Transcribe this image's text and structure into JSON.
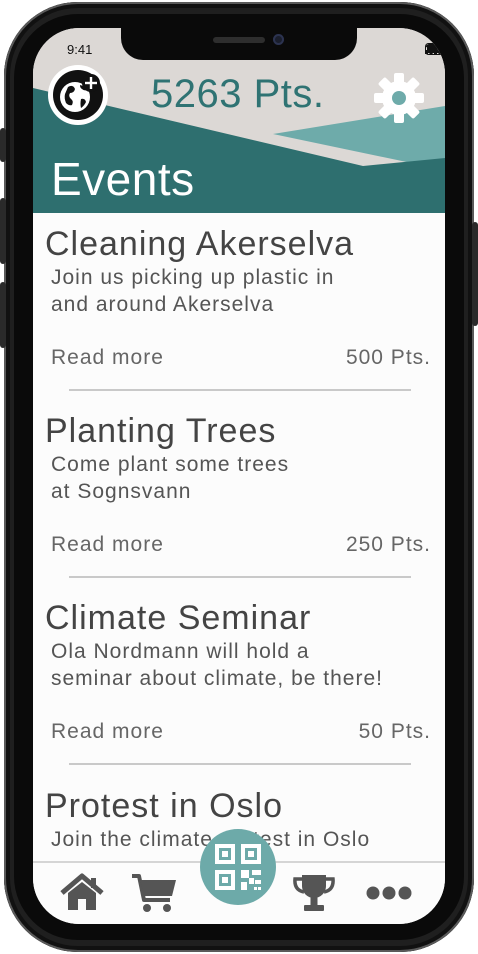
{
  "status_bar": {
    "time": "9:41"
  },
  "header": {
    "points": "5263 Pts.",
    "title": "Events",
    "colors": {
      "teal_dark": "#2e6f6f",
      "teal_light": "#6eabaa",
      "points_text": "#2f7373"
    }
  },
  "icons": {
    "globe": "globe-plus-icon",
    "settings": "gear-icon",
    "home": "home-icon",
    "cart": "cart-icon",
    "qr": "qr-code-icon",
    "trophy": "trophy-icon",
    "more": "more-dots-icon"
  },
  "events": [
    {
      "title": "Cleaning Akerselva",
      "description_lines": [
        "Join us picking up plastic in",
        "and around Akerselva"
      ],
      "read_more": "Read more",
      "points": "500 Pts."
    },
    {
      "title": "Planting Trees",
      "description_lines": [
        "Come plant some trees",
        "at Sognsvann"
      ],
      "read_more": "Read more",
      "points": "250 Pts."
    },
    {
      "title": "Climate Seminar",
      "description_lines": [
        "Ola Nordmann will hold a",
        "seminar about climate, be there!"
      ],
      "read_more": "Read more",
      "points": "50 Pts."
    },
    {
      "title": "Protest in Oslo",
      "description_lines": [
        "Join the climate protest in Oslo",
        ""
      ],
      "read_more": "",
      "points": ""
    }
  ]
}
